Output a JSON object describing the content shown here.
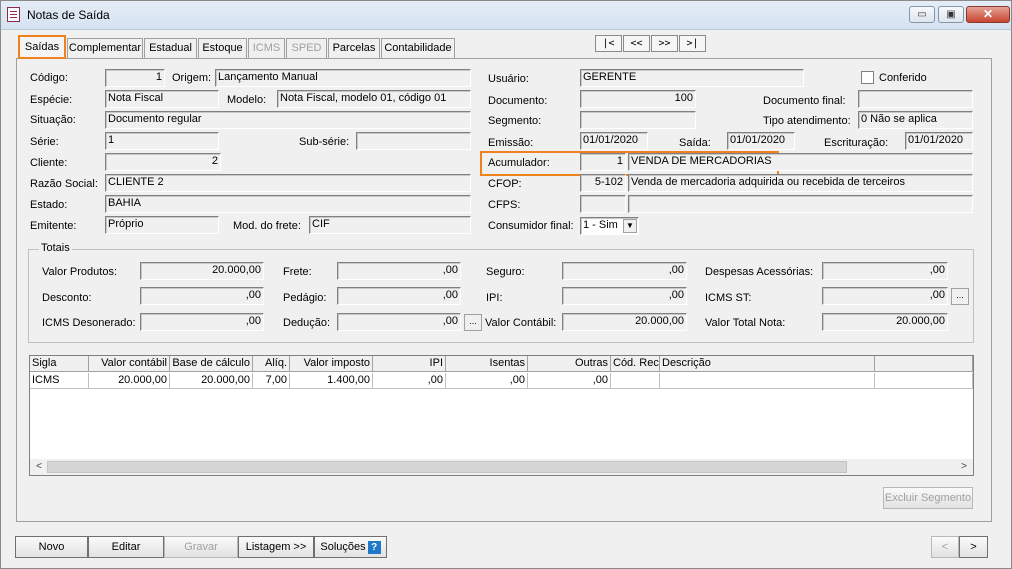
{
  "window": {
    "title": "Notas de Saída",
    "min": "▭",
    "max": "▣",
    "close": "✕"
  },
  "tabs": [
    {
      "label": "Saídas"
    },
    {
      "label": "Complementar"
    },
    {
      "label": "Estadual"
    },
    {
      "label": "Estoque"
    },
    {
      "label": "ICMS"
    },
    {
      "label": "SPED"
    },
    {
      "label": "Parcelas"
    },
    {
      "label": "Contabilidade"
    }
  ],
  "nav": {
    "first": "|<",
    "prev": "<<",
    "next": ">>",
    "last": ">|"
  },
  "form": {
    "codigo_label": "Código:",
    "codigo": "1",
    "origem_label": "Origem:",
    "origem": "Lançamento Manual",
    "especie_label": "Espécie:",
    "especie": "Nota Fiscal",
    "modelo_label": "Modelo:",
    "modelo": "Nota Fiscal, modelo 01, código 01",
    "situacao_label": "Situação:",
    "situacao": "Documento regular",
    "serie_label": "Série:",
    "serie": "1",
    "subserie_label": "Sub-série:",
    "subserie": "",
    "cliente_label": "Cliente:",
    "cliente": "2",
    "razao_label": "Razão Social:",
    "razao": "CLIENTE 2",
    "estado_label": "Estado:",
    "estado": "BAHIA",
    "emitente_label": "Emitente:",
    "emitente": "Próprio",
    "frete_mod_label": "Mod. do frete:",
    "frete_mod": "CIF",
    "usuario_label": "Usuário:",
    "usuario": "GERENTE",
    "conferido_label": "Conferido",
    "documento_label": "Documento:",
    "documento": "100",
    "docfinal_label": "Documento final:",
    "docfinal": "",
    "segmento_label": "Segmento:",
    "segmento": "",
    "tipoatend_label": "Tipo atendimento:",
    "tipoatend": "0 Não se aplica",
    "emissao_label": "Emissão:",
    "emissao": "01/01/2020",
    "saida_label": "Saída:",
    "saida": "01/01/2020",
    "escrit_label": "Escrituração:",
    "escrit": "01/01/2020",
    "acumulador_label": "Acumulador:",
    "acumulador_code": "1",
    "acumulador_desc": "VENDA DE MERCADORIAS",
    "cfop_label": "CFOP:",
    "cfop_code": "5-102",
    "cfop_desc": "Venda de mercadoria adquirida ou recebida de terceiros",
    "cfps_label": "CFPS:",
    "cfps_code": "",
    "cfps_desc": "",
    "consumidor_label": "Consumidor final:",
    "consumidor": "1 - Sim"
  },
  "totais": {
    "title": "Totais",
    "valor_produtos_label": "Valor Produtos:",
    "valor_produtos": "20.000,00",
    "frete_label": "Frete:",
    "frete": ",00",
    "seguro_label": "Seguro:",
    "seguro": ",00",
    "despesas_label": "Despesas Acessórias:",
    "despesas": ",00",
    "desconto_label": "Desconto:",
    "desconto": ",00",
    "pedagio_label": "Pedágio:",
    "pedagio": ",00",
    "ipi_label": "IPI:",
    "ipi": ",00",
    "icmsst_label": "ICMS ST:",
    "icmsst": ",00",
    "icmsdes_label": "ICMS Desonerado:",
    "icmsdes": ",00",
    "deducao_label": "Dedução:",
    "deducao": ",00",
    "valcontabil_label": "Valor Contábil:",
    "valcontabil": "20.000,00",
    "valtotal_label": "Valor Total Nota:",
    "valtotal": "20.000,00",
    "ellipsis": "..."
  },
  "grid": {
    "headers": [
      "Sigla",
      "Valor contábil",
      "Base de cálculo",
      "Alíq.",
      "Valor imposto",
      "IPI",
      "Isentas",
      "Outras",
      "Cód. Rec.",
      "Descrição"
    ],
    "row": [
      "ICMS",
      "20.000,00",
      "20.000,00",
      "7,00",
      "1.400,00",
      ",00",
      ",00",
      ",00",
      "",
      ""
    ],
    "scroll_left": "<",
    "scroll_right": ">"
  },
  "buttons": {
    "excluir": "Excluir Segmento",
    "novo": "Novo",
    "editar": "Editar",
    "gravar": "Gravar",
    "listagem": "Listagem >>",
    "solucoes": "Soluções",
    "help": "?",
    "prev": "<",
    "next": ">"
  }
}
